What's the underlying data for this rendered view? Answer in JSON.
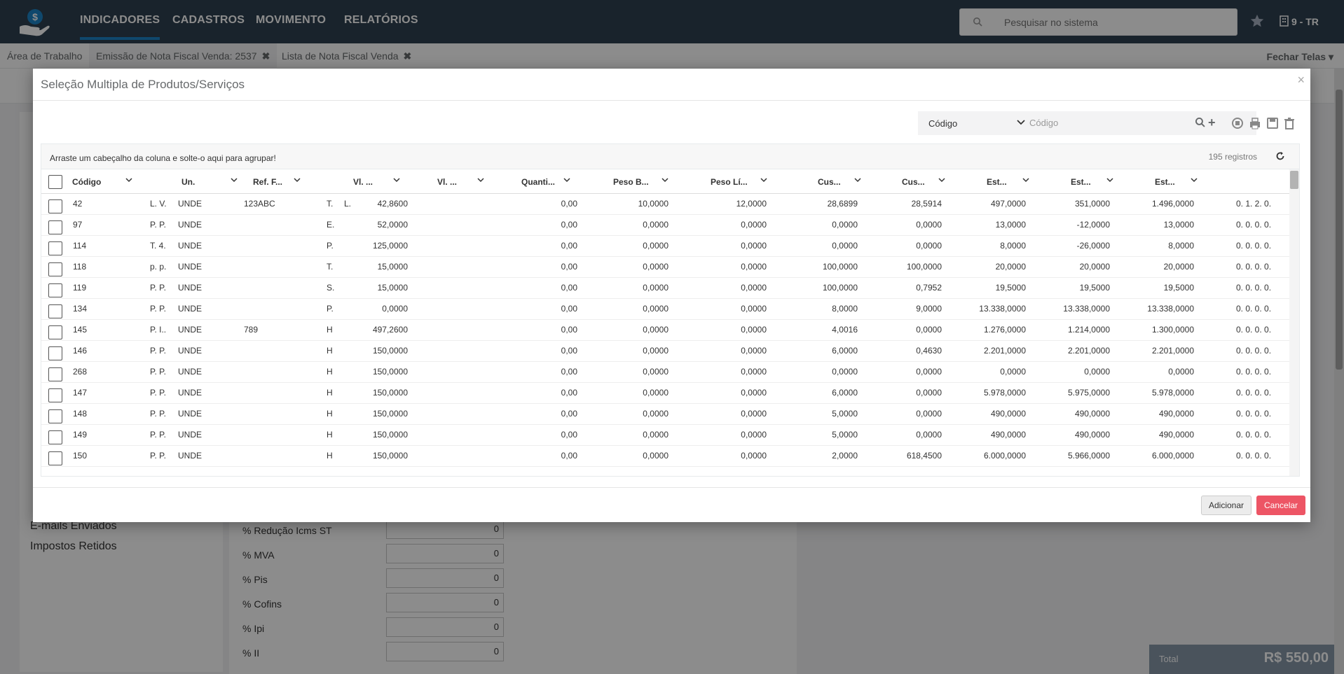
{
  "topbar": {
    "nav": [
      "INDICADORES",
      "CADASTROS",
      "MOVIMENTO",
      "RELATÓRIOS"
    ],
    "search_placeholder": "Pesquisar no sistema",
    "company": "9 - TR"
  },
  "tabs": {
    "items": [
      "Área de Trabalho",
      "Emissão de Nota Fiscal Venda: 2537",
      "Lista de Nota Fiscal Venda"
    ],
    "close_all": "Fechar Telas"
  },
  "background": {
    "left_items": [
      "E-mails Enviados",
      "Impostos Retidos"
    ],
    "form_rows": [
      {
        "label": "% Redução Icms ST",
        "value": "0"
      },
      {
        "label": "% MVA",
        "value": "0"
      },
      {
        "label": "% Pis",
        "value": "0"
      },
      {
        "label": "% Cofins",
        "value": "0"
      },
      {
        "label": "% Ipi",
        "value": "0"
      },
      {
        "label": "% II",
        "value": "0"
      }
    ],
    "total_label": "Total",
    "total_value": "R$ 550,00"
  },
  "modal": {
    "title": "Seleção Multipla de Produtos/Serviços",
    "close": "×",
    "filter_field": "Código",
    "filter_placeholder": "Código",
    "group_hint": "Arraste um cabeçalho da coluna e solte-o aqui para agrupar!",
    "record_count": "195 registros",
    "columns": [
      "Código",
      "",
      "Un.",
      "Ref. F...",
      "",
      "Vl. ...",
      "Vl. ...",
      "Quanti...",
      "Peso B...",
      "Peso Lí...",
      "Cus...",
      "Cus...",
      "Est...",
      "Est...",
      "Est...",
      ""
    ],
    "rows": [
      [
        "42",
        "L. V.",
        "UNDE",
        "123ABC",
        "T.",
        "L.",
        "42,8600",
        "",
        "0,00",
        "10,0000",
        "12,0000",
        "28,6899",
        "28,5914",
        "497,0000",
        "351,0000",
        "1.496,0000",
        "0. 1. 2. 0."
      ],
      [
        "97",
        "P. P.",
        "UNDE",
        "",
        "E.",
        "",
        "52,0000",
        "",
        "0,00",
        "0,0000",
        "0,0000",
        "0,0000",
        "0,0000",
        "13,0000",
        "-12,0000",
        "13,0000",
        "0. 0. 0. 0."
      ],
      [
        "114",
        "T. 4.",
        "UNDE",
        "",
        "P.",
        "",
        "125,0000",
        "",
        "0,00",
        "0,0000",
        "0,0000",
        "0,0000",
        "0,0000",
        "8,0000",
        "-26,0000",
        "8,0000",
        "0. 0. 0. 0."
      ],
      [
        "118",
        "p. p.",
        "UNDE",
        "",
        "T.",
        "",
        "15,0000",
        "",
        "0,00",
        "0,0000",
        "0,0000",
        "100,0000",
        "100,0000",
        "20,0000",
        "20,0000",
        "20,0000",
        "0. 0. 0. 0."
      ],
      [
        "119",
        "P. P.",
        "UNDE",
        "",
        "S.",
        "",
        "15,0000",
        "",
        "0,00",
        "0,0000",
        "0,0000",
        "100,0000",
        "0,7952",
        "19,5000",
        "19,5000",
        "19,5000",
        "0. 0. 0. 0."
      ],
      [
        "134",
        "P. P.",
        "UNDE",
        "",
        "P.",
        "",
        "0,0000",
        "",
        "0,00",
        "0,0000",
        "0,0000",
        "8,0000",
        "9,0000",
        "13.338,0000",
        "13.338,0000",
        "13.338,0000",
        "0. 0. 0. 0."
      ],
      [
        "145",
        "P. I..",
        "UNDE",
        "789",
        "H",
        "",
        "497,2600",
        "",
        "0,00",
        "0,0000",
        "0,0000",
        "4,0016",
        "0,0000",
        "1.276,0000",
        "1.214,0000",
        "1.300,0000",
        "0. 0. 0. 0."
      ],
      [
        "146",
        "P. P.",
        "UNDE",
        "",
        "H",
        "",
        "150,0000",
        "",
        "0,00",
        "0,0000",
        "0,0000",
        "6,0000",
        "0,4630",
        "2.201,0000",
        "2.201,0000",
        "2.201,0000",
        "0. 0. 0. 0."
      ],
      [
        "268",
        "P. P.",
        "UNDE",
        "",
        "H",
        "",
        "150,0000",
        "",
        "0,00",
        "0,0000",
        "0,0000",
        "0,0000",
        "0,0000",
        "0,0000",
        "0,0000",
        "0,0000",
        "0. 0. 0. 0."
      ],
      [
        "147",
        "P. P.",
        "UNDE",
        "",
        "H",
        "",
        "150,0000",
        "",
        "0,00",
        "0,0000",
        "0,0000",
        "6,0000",
        "0,0000",
        "5.978,0000",
        "5.975,0000",
        "5.978,0000",
        "0. 0. 0. 0."
      ],
      [
        "148",
        "P. P.",
        "UNDE",
        "",
        "H",
        "",
        "150,0000",
        "",
        "0,00",
        "0,0000",
        "0,0000",
        "5,0000",
        "0,0000",
        "490,0000",
        "490,0000",
        "490,0000",
        "0. 0. 0. 0."
      ],
      [
        "149",
        "P. P.",
        "UNDE",
        "",
        "H",
        "",
        "150,0000",
        "",
        "0,00",
        "0,0000",
        "0,0000",
        "5,0000",
        "0,0000",
        "490,0000",
        "490,0000",
        "490,0000",
        "0. 0. 0. 0."
      ],
      [
        "150",
        "P. P.",
        "UNDE",
        "",
        "H",
        "",
        "150,0000",
        "",
        "0,00",
        "0,0000",
        "0,0000",
        "2,0000",
        "618,4500",
        "6.000,0000",
        "5.966,0000",
        "6.000,0000",
        "0. 0. 0. 0."
      ]
    ],
    "buttons": {
      "add": "Adicionar",
      "cancel": "Cancelar"
    }
  },
  "colors": {
    "navbar": "#2f4050",
    "accent": "#1c84c6",
    "cancel": "#ed5565"
  },
  "icons": [
    "logo-dollar-hand-icon",
    "search-icon",
    "star-icon",
    "building-icon",
    "chevron-down-icon",
    "plus-icon",
    "refresh-icon",
    "save-icon",
    "trash-icon",
    "print-icon",
    "close-icon"
  ]
}
